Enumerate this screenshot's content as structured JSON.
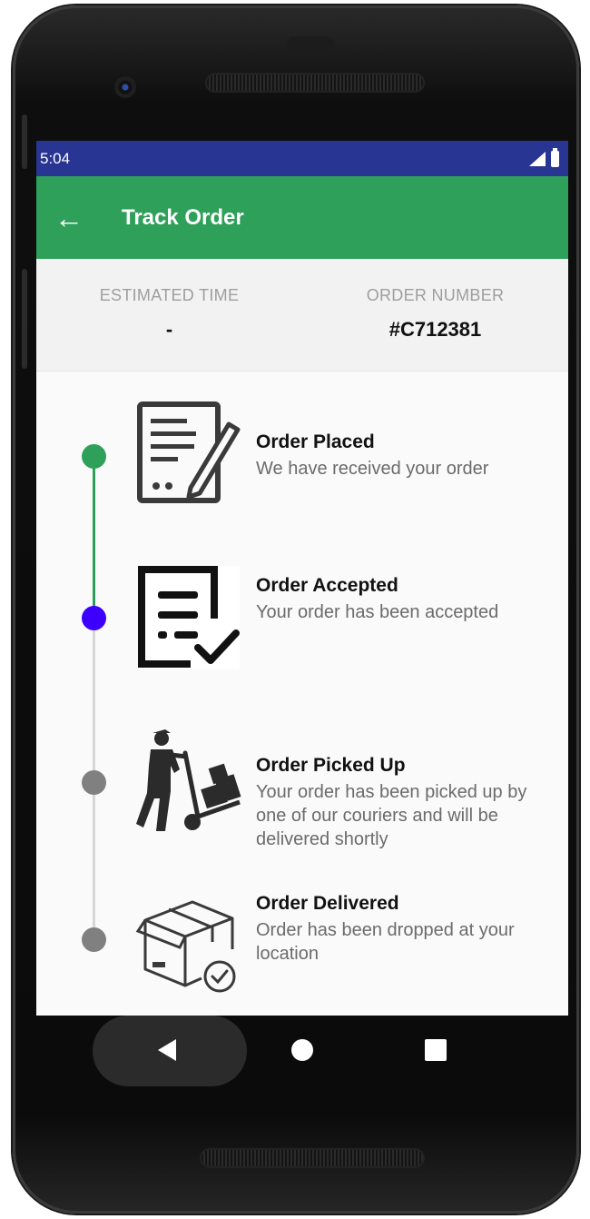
{
  "status_bar": {
    "time": "5:04",
    "icons": [
      "signal-icon",
      "battery-icon"
    ]
  },
  "app_bar": {
    "title": "Track Order",
    "back_icon": "arrow-left-icon"
  },
  "summary": {
    "estimated_time": {
      "label": "ESTIMATED TIME",
      "value": "-"
    },
    "order_number": {
      "label": "ORDER NUMBER",
      "value": "#C712381"
    }
  },
  "steps": [
    {
      "title": "Order Placed",
      "description": "We have received your order",
      "icon": "document-sign-icon",
      "status_color": "#2ea05a",
      "state": "done"
    },
    {
      "title": "Order Accepted",
      "description": "Your order has been accepted",
      "icon": "checklist-icon",
      "status_color": "#3d00ff",
      "state": "current"
    },
    {
      "title": "Order Picked Up",
      "description": "Your order has been picked up by one of our couriers and will be delivered shortly",
      "icon": "courier-icon",
      "status_color": "#808080",
      "state": "pending"
    },
    {
      "title": "Order Delivered",
      "description": "Order has been dropped at your location",
      "icon": "package-delivered-icon",
      "status_color": "#808080",
      "state": "pending"
    }
  ],
  "colors": {
    "status_bar": "#283593",
    "app_bar": "#2ea05a",
    "done": "#2ea05a",
    "current": "#3d00ff",
    "pending": "#808080",
    "pending_line": "#d6d6d6"
  },
  "navigation": {
    "buttons": [
      "back-triangle-icon",
      "home-circle-icon",
      "recents-square-icon"
    ]
  }
}
